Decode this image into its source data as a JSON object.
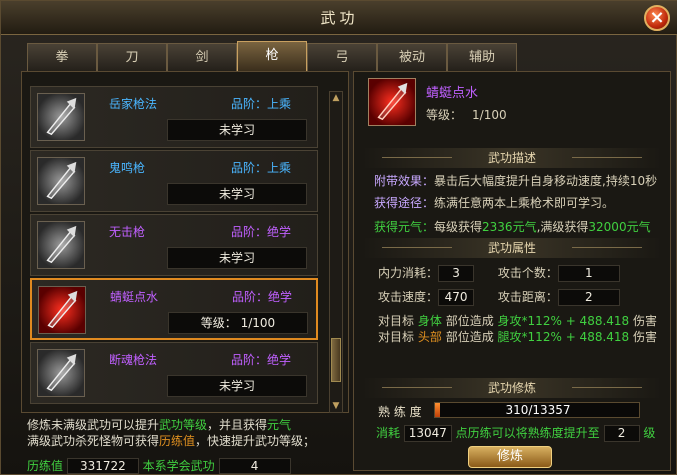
{
  "window": {
    "title": "武功",
    "close_icon": "close-icon"
  },
  "tabs": [
    "拳",
    "刀",
    "剑",
    "枪",
    "弓",
    "被动",
    "辅助"
  ],
  "active_tab": 3,
  "skills": [
    {
      "name": "岳家枪法",
      "rank": "品阶：上乘",
      "status": "未学习",
      "icon": "spear-icon",
      "color": "blue"
    },
    {
      "name": "鬼鸣枪",
      "rank": "品阶：上乘",
      "status": "未学习",
      "icon": "spear-icon",
      "color": "blue"
    },
    {
      "name": "无击枪",
      "rank": "品阶：绝学",
      "status": "未学习",
      "icon": "spear-icon",
      "color": "purple"
    },
    {
      "name": "蜻蜓点水",
      "rank": "品阶：绝学",
      "status": "等级：    1/100",
      "icon": "spear-icon",
      "color": "purple"
    },
    {
      "name": "断魂枪法",
      "rank": "品阶：绝学",
      "status": "未学习",
      "icon": "spear-icon",
      "color": "purple"
    }
  ],
  "note": {
    "l1a": "修炼未满级武功可以提升",
    "l1b": "武功等级",
    "l1c": "，并且获得",
    "l1d": "元气",
    "l2a": "满级武功杀死怪物可获得",
    "l2b": "历练值",
    "l2c": "，快速提升武功等级；"
  },
  "learn": {
    "exp_label": "历练值",
    "exp_value": "331722",
    "learned_label": "本系学会武功",
    "learned_value": "4"
  },
  "detail": {
    "name": "蜻蜓点水",
    "level_label": "等级：",
    "level_value": "1/100",
    "desc_title": "武功描述",
    "effect_label": "附带效果：",
    "effect_text": "暴击后大幅度提升自身移动速度,持续10秒",
    "path_label": "获得途径：",
    "path_text": "练满任意两本上乘枪术即可学习。",
    "yuanqi_label": "获得元气：",
    "yuanqi_a": "每级获得",
    "yuanqi_b": "2336元气",
    "yuanqi_c": ",满级获得",
    "yuanqi_d": "32000元气",
    "attr_title": "武功属性",
    "neili_label": "内力消耗：",
    "neili_value": "3",
    "count_label": "攻击个数：",
    "count_value": "1",
    "speed_label": "攻击速度：",
    "speed_value": "470",
    "range_label": "攻击距离：",
    "range_value": "2",
    "dmg1": {
      "a": "对目标",
      "b": "身体",
      "c": "部位造成",
      "d": "身攻",
      "e": "*112%",
      "f": "+ 488.418",
      "g": "伤害"
    },
    "dmg2": {
      "a": "对目标",
      "b": "头部",
      "c": "部位造成",
      "d": "腿攻",
      "e": "*112%",
      "f": "+ 488.418",
      "g": "伤害"
    },
    "train_title": "武功修炼",
    "prof_label": "熟 练 度",
    "prof_value": "310/13357",
    "prof_fraction": 0.0232,
    "xiaohao_label": "消耗",
    "xiaohao_value": "13047",
    "upgrade_text": "点历练可以将熟练度提升至",
    "upgrade_value": "2",
    "upgrade_unit": "级",
    "train_button": "修炼"
  }
}
